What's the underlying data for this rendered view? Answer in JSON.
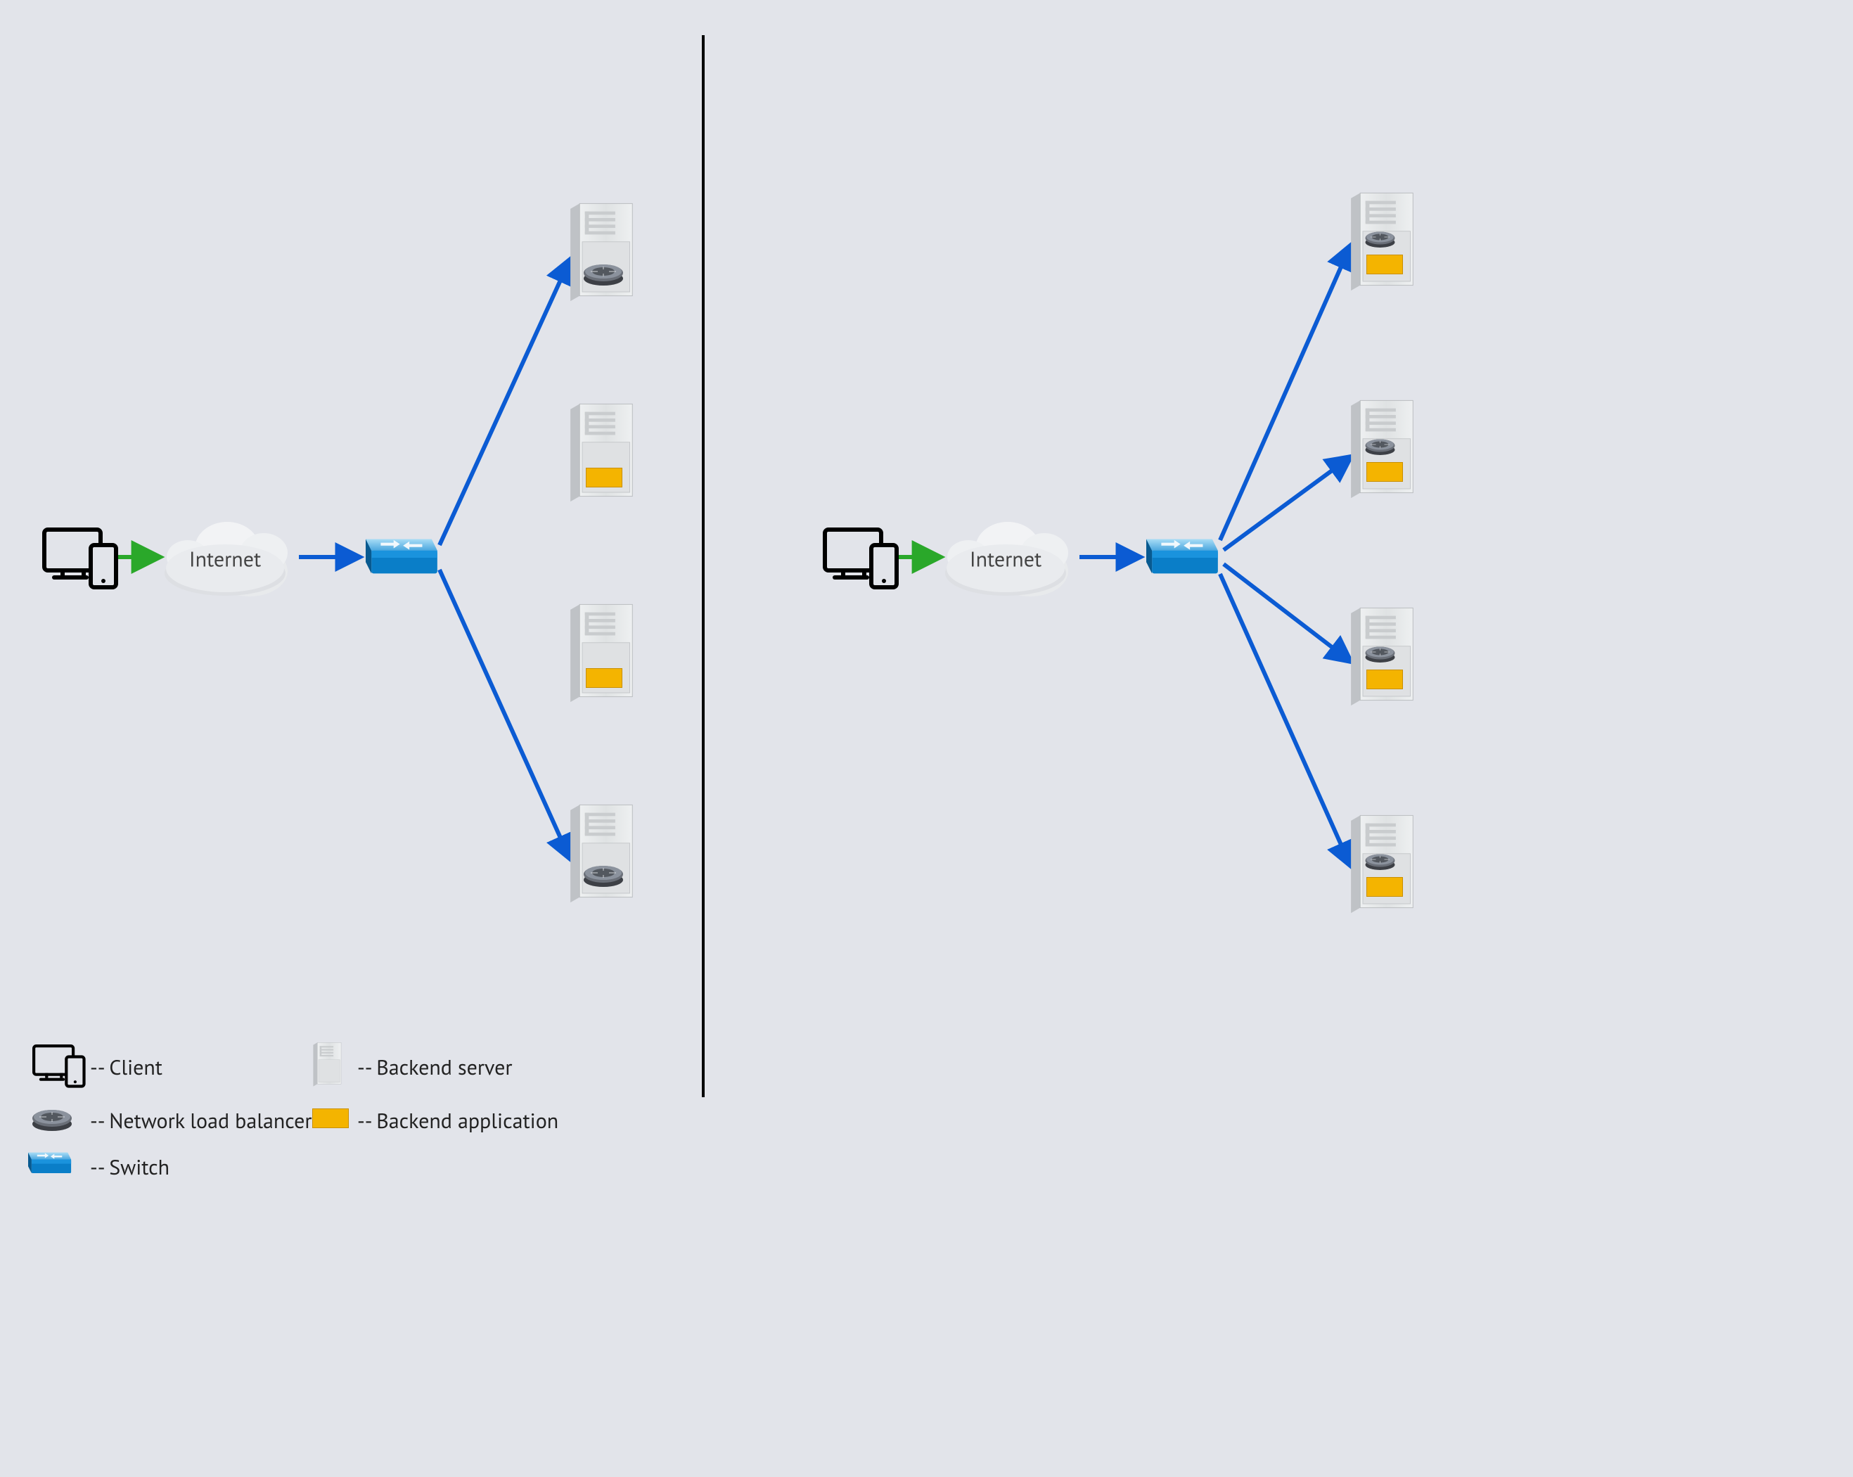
{
  "cloud_label_left": "Internet",
  "cloud_label_right": "Internet",
  "legend": {
    "client": "-- Client",
    "nlb": "-- Network load balancer",
    "switch": "-- Switch",
    "server": "-- Backend server",
    "app": "-- Backend application"
  },
  "colors": {
    "bg": "#e2e4ea",
    "arrow_green": "#2aa82a",
    "arrow_blue": "#0b5bd3",
    "switch_top": "#5cb6ea",
    "switch_front": "#0a7ec8",
    "app": "#f4b400",
    "divider": "#000"
  },
  "diagram": {
    "description": "Two side-by-side network topologies separated by a vertical divider. Each shows Client → Internet cloud → Switch → four backend servers. Left side: servers 1 & 4 host a network load balancer; servers 2 & 3 host the backend application; switch arrows go only to servers 1 and 4. Right side: every server hosts both a load balancer and the application; switch arrows go to all four servers.",
    "left_servers": [
      {
        "has_nlb": true,
        "has_app": false,
        "arrow_from_switch": true
      },
      {
        "has_nlb": false,
        "has_app": true,
        "arrow_from_switch": false
      },
      {
        "has_nlb": false,
        "has_app": true,
        "arrow_from_switch": false
      },
      {
        "has_nlb": true,
        "has_app": false,
        "arrow_from_switch": true
      }
    ],
    "right_servers": [
      {
        "has_nlb": true,
        "has_app": true,
        "arrow_from_switch": true
      },
      {
        "has_nlb": true,
        "has_app": true,
        "arrow_from_switch": true
      },
      {
        "has_nlb": true,
        "has_app": true,
        "arrow_from_switch": true
      },
      {
        "has_nlb": true,
        "has_app": true,
        "arrow_from_switch": true
      }
    ]
  }
}
